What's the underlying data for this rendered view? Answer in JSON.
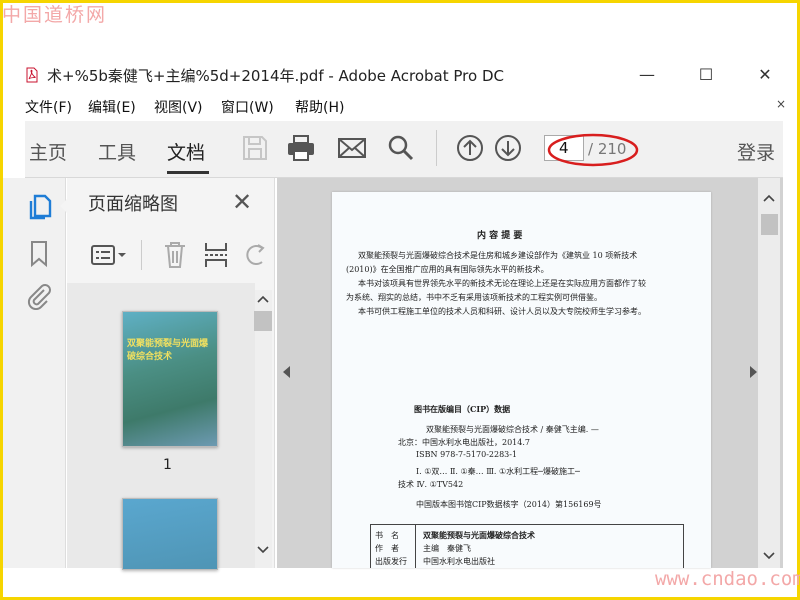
{
  "watermark": {
    "top": "中国道桥网",
    "bottom": "www.cndao.com"
  },
  "window": {
    "title": "术+%5b秦健飞+主编%5d+2014年.pdf - Adobe Acrobat Pro DC",
    "minimize": "—",
    "maximize": "☐",
    "close": "✕"
  },
  "menu": {
    "items": [
      "文件(F)",
      "编辑(E)",
      "视图(V)",
      "窗口(W)",
      "帮助(H)"
    ],
    "close": "×"
  },
  "toolbar": {
    "tabs": [
      "主页",
      "工具",
      "文档"
    ],
    "active_tab": "文档",
    "page_current": "4",
    "page_total": "/ 210",
    "login": "登录",
    "annotation_color": "#d81e1e"
  },
  "nav_panel": {
    "title": "页面缩略图",
    "close": "✕",
    "thumb_page_num": "1",
    "thumb_cover_title": "双聚能预裂与光面爆破综合技术"
  },
  "document": {
    "heading": "内 容 提 要",
    "summary": [
      "双聚能预裂与光面爆破综合技术是住房和城乡建设部作为《建筑业 10 项新技术",
      "(2010)》在全国推广应用的具有国际领先水平的新技术。",
      "本书对该项具有世界领先水平的新技术无论在理论上还是在实际应用方面都作了较",
      "为系统、翔实的总结，书中不乏有采用该项新技术的工程实例可供借鉴。",
      "本书可供工程施工单位的技术人员和科研、设计人员以及大专院校师生学习参考。"
    ],
    "cip_heading": "图书在版编目（CIP）数据",
    "cip_lines": [
      "双聚能预裂与光面爆破综合技术 / 秦健飞主编. —",
      "北京：中国水利水电出版社，2014.7",
      "ISBN 978-7-5170-2283-1",
      "Ⅰ. ①双…  Ⅱ. ①秦…  Ⅲ. ①水利工程─爆破施工─",
      "技术  Ⅳ. ①TV542",
      "中国版本图书馆CIP数据核字（2014）第156169号"
    ],
    "table_rows": [
      {
        "label": "书　名",
        "value": "双聚能预裂与光面爆破综合技术"
      },
      {
        "label": "作　者",
        "value": "主编　秦健飞"
      },
      {
        "label": "出版发行",
        "value": "中国水利水电出版社"
      }
    ]
  }
}
